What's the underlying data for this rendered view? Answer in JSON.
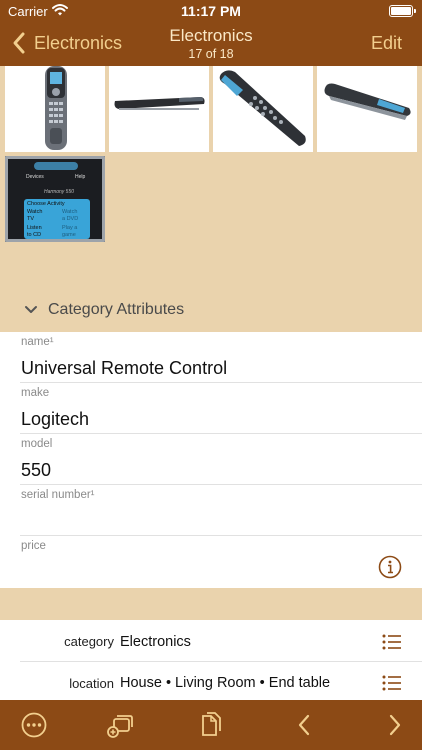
{
  "status": {
    "carrier": "Carrier",
    "time": "11:17 PM"
  },
  "nav": {
    "back_label": "Electronics",
    "title": "Electronics",
    "subtitle": "17 of 18",
    "edit_label": "Edit"
  },
  "category_section": {
    "title": "Category Attributes"
  },
  "attributes": [
    {
      "key": "name¹",
      "value": "Universal Remote Control"
    },
    {
      "key": "make",
      "value": "Logitech"
    },
    {
      "key": "model",
      "value": "550"
    },
    {
      "key": "serial number¹",
      "value": ""
    },
    {
      "key": "price",
      "value": ""
    }
  ],
  "meta": {
    "category": {
      "key": "category",
      "value": "Electronics"
    },
    "location": {
      "key": "location",
      "value": "House • Living Room • End table"
    }
  },
  "screen_text": {
    "remote_buttons": [
      "Devices",
      "Help"
    ],
    "remote_model": "Harmony 550",
    "remote_menu": [
      [
        "Choose Activity"
      ],
      [
        "Watch",
        "Watch"
      ],
      [
        "TV",
        "a DVD"
      ],
      [
        "Listen",
        "Play a"
      ],
      [
        "to CD",
        "game"
      ]
    ]
  },
  "colors": {
    "bar": "#8c4a15",
    "bar_text": "#f2cf8e",
    "background": "#ead3ad",
    "accent_icon": "#8c4a15"
  },
  "icons": [
    "wifi-icon",
    "battery-icon",
    "back-chevron-icon",
    "disclosure-chevron-icon",
    "info-icon",
    "list-icon",
    "more-icon",
    "add-copy-icon",
    "duplicate-icon",
    "previous-icon",
    "next-icon"
  ]
}
